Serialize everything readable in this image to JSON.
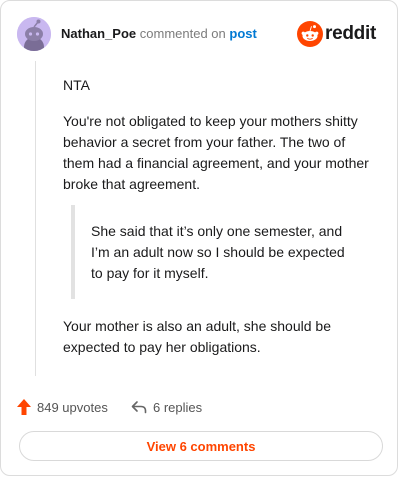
{
  "header": {
    "username": "Nathan_Poe",
    "action": "commented on",
    "post_link": "post",
    "brand": "reddit",
    "avatar_icon": "snoo-avatar-icon",
    "brand_color": "#ff4500"
  },
  "comment": {
    "p1": "NTA",
    "p2": "You're not obligated to keep your mothers shitty behavior a secret from your father. The two of them had a financial agreement, and your mother broke that agreement.",
    "quote": "She said that it’s only one semester, and I’m an adult now so I should be expected to pay for it myself.",
    "p3": "Your mother is also an adult, she should be expected to pay her obligations."
  },
  "actions": {
    "upvotes": "849 upvotes",
    "replies": "6 replies",
    "view_comments": "View 6 comments"
  }
}
